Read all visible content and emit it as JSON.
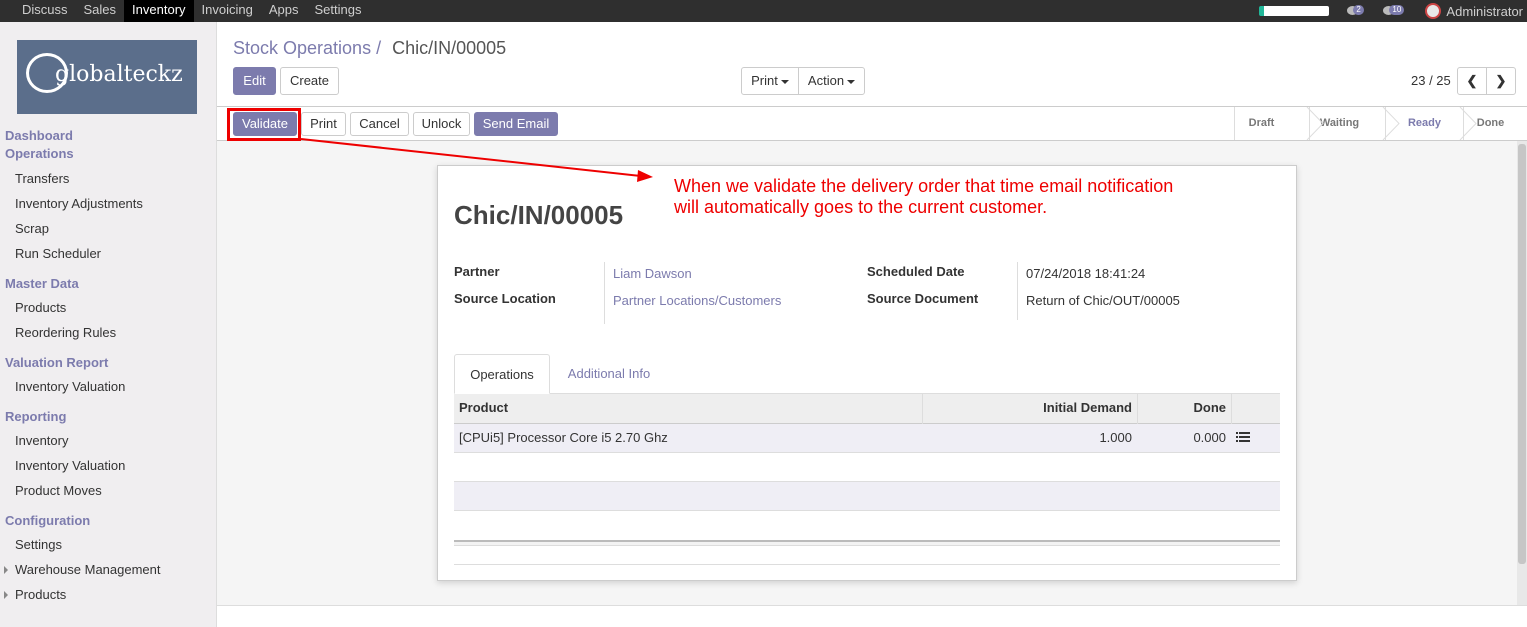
{
  "topbar": {
    "menu": [
      "Discuss",
      "Sales",
      "Inventory",
      "Invoicing",
      "Apps",
      "Settings"
    ],
    "active": "Inventory",
    "chat_badge": "2",
    "msg_badge": "10",
    "user": "Administrator"
  },
  "sidebar": {
    "logo_text": "globalteckz",
    "sections": {
      "dashboard": "Dashboard",
      "operations": "Operations",
      "master_data": "Master Data",
      "valuation_report": "Valuation Report",
      "reporting": "Reporting",
      "configuration": "Configuration"
    },
    "items": {
      "transfers": "Transfers",
      "inventory_adjustments": "Inventory Adjustments",
      "scrap": "Scrap",
      "run_scheduler": "Run Scheduler",
      "products": "Products",
      "reordering_rules": "Reordering Rules",
      "inventory_valuation": "Inventory Valuation",
      "inventory": "Inventory",
      "inventory_valuation_2": "Inventory Valuation",
      "product_moves": "Product Moves",
      "settings": "Settings",
      "warehouse_management": "Warehouse Management",
      "products_2": "Products"
    }
  },
  "header": {
    "breadcrumb_parent": "Stock Operations",
    "breadcrumb_sep": "/",
    "breadcrumb_current": "Chic/IN/00005",
    "edit": "Edit",
    "create": "Create",
    "print": "Print",
    "action": "Action",
    "pager": "23 / 25"
  },
  "statusbar": {
    "validate": "Validate",
    "print": "Print",
    "cancel": "Cancel",
    "unlock": "Unlock",
    "send_email": "Send Email",
    "stages": [
      "Draft",
      "Waiting",
      "Ready",
      "Done"
    ],
    "current_stage": "Ready"
  },
  "annotation": {
    "text": "When we validate the delivery order that time email notification will automatically goes to the current customer.",
    "color": "#e00000"
  },
  "record": {
    "name": "Chic/IN/00005",
    "partner_label": "Partner",
    "partner": "Liam Dawson",
    "source_location_label": "Source Location",
    "source_location": "Partner Locations/Customers",
    "scheduled_date_label": "Scheduled Date",
    "scheduled_date": "07/24/2018 18:41:24",
    "source_document_label": "Source Document",
    "source_document": "Return of Chic/OUT/00005"
  },
  "tabs": {
    "operations": "Operations",
    "additional_info": "Additional Info"
  },
  "table": {
    "headers": [
      "Product",
      "Initial Demand",
      "Done"
    ],
    "rows": [
      {
        "product": "[CPUi5] Processor Core i5 2.70 Ghz",
        "initial_demand": "1.000",
        "done": "0.000"
      }
    ]
  },
  "colors": {
    "accent": "#7c7bad",
    "topbar": "#2f2f2f"
  }
}
